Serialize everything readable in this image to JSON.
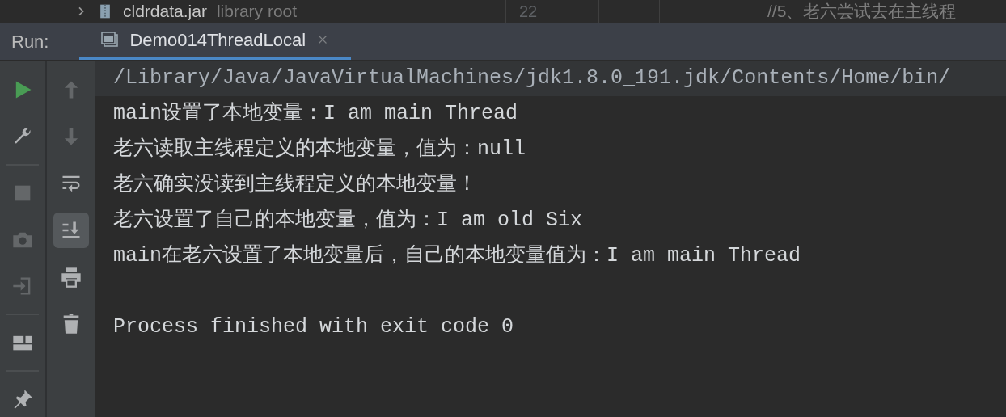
{
  "editor_strip": {
    "tree_item": {
      "name": "cldrdata.jar",
      "note": "library root"
    },
    "line_number": "22",
    "code": "//5、老六尝试去在主线程"
  },
  "run_bar": {
    "label": "Run:",
    "tabs": [
      {
        "label": "Demo014ThreadLocal",
        "selected": true
      }
    ]
  },
  "left_toolbar": [
    {
      "kind": "run",
      "disabled": false
    },
    {
      "kind": "build",
      "disabled": false
    },
    {
      "kind": "sep"
    },
    {
      "kind": "stop",
      "disabled": true
    },
    {
      "kind": "camera",
      "disabled": true
    },
    {
      "kind": "login",
      "disabled": true
    },
    {
      "kind": "sep"
    },
    {
      "kind": "layout",
      "disabled": false
    },
    {
      "kind": "sep"
    },
    {
      "kind": "pin",
      "disabled": false
    }
  ],
  "right_toolbar": [
    {
      "kind": "up",
      "disabled": true
    },
    {
      "kind": "down",
      "disabled": true
    },
    {
      "kind": "wrap",
      "disabled": false,
      "selected": false
    },
    {
      "kind": "scroll",
      "disabled": false,
      "selected": true
    },
    {
      "kind": "print",
      "disabled": false,
      "selected": false
    },
    {
      "kind": "trash",
      "disabled": false,
      "selected": false
    }
  ],
  "console": [
    {
      "kind": "command",
      "text": "/Library/Java/JavaVirtualMachines/jdk1.8.0_191.jdk/Contents/Home/bin/"
    },
    {
      "kind": "output",
      "text": "main设置了本地变量：I am main Thread"
    },
    {
      "kind": "output",
      "text": "老六读取主线程定义的本地变量，值为：null"
    },
    {
      "kind": "output",
      "text": "老六确实没读到主线程定义的本地变量！"
    },
    {
      "kind": "output",
      "text": "老六设置了自己的本地变量，值为：I am old Six"
    },
    {
      "kind": "output",
      "text": "main在老六设置了本地变量后，自己的本地变量值为：I am main Thread"
    },
    {
      "kind": "blank"
    },
    {
      "kind": "output",
      "text": "Process finished with exit code 0"
    }
  ]
}
